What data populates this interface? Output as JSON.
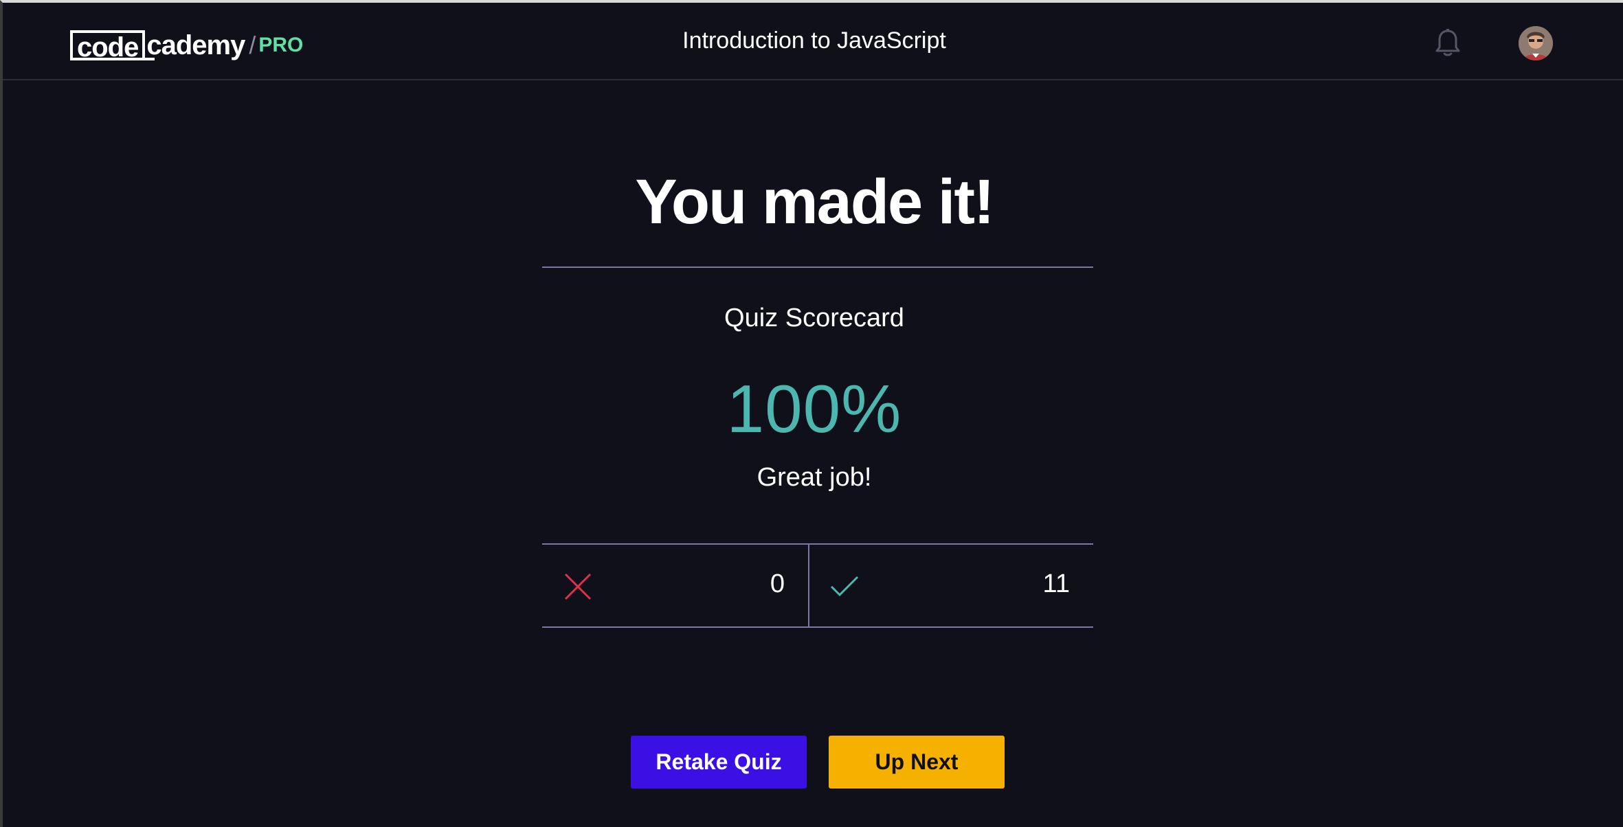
{
  "header": {
    "logo": {
      "code": "code",
      "cademy": "cademy",
      "slash": "/",
      "pro": "PRO"
    },
    "course_title": "Introduction to JavaScript",
    "icons": {
      "notifications": "bell-icon",
      "profile": "avatar"
    }
  },
  "main": {
    "headline": "You made it!",
    "scorecard_label": "Quiz Scorecard",
    "score_percent": "100%",
    "message": "Great job!",
    "tally": {
      "incorrect": {
        "icon": "x-icon",
        "count": "0"
      },
      "correct": {
        "icon": "check-icon",
        "count": "11"
      }
    },
    "buttons": {
      "retake": "Retake Quiz",
      "next": "Up Next"
    }
  },
  "colors": {
    "background": "#10101a",
    "score": "#4cb7ae",
    "incorrect": "#e0314b",
    "correct": "#4cb7ae",
    "retake_button": "#3a10e5",
    "next_button": "#f5b000",
    "pro_badge": "#5fe1a6",
    "divider": "#7b78a8"
  }
}
